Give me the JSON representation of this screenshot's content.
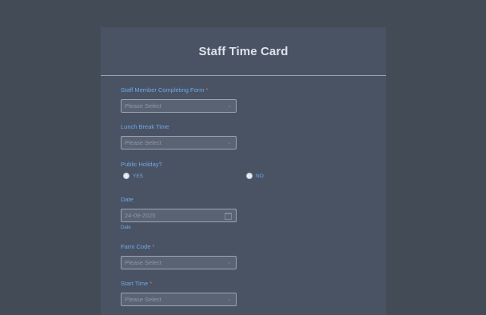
{
  "form": {
    "title": "Staff Time Card",
    "fields": {
      "staff_member": {
        "label": "Staff Member Completing Form",
        "required_mark": "*",
        "placeholder": "Please Select"
      },
      "lunch_break": {
        "label": "Lunch Break Time",
        "placeholder": "Please Select"
      },
      "public_holiday": {
        "label": "Public Holiday?",
        "options": [
          "YES",
          "NO"
        ]
      },
      "date": {
        "label": "Date",
        "value": "24-09-2025",
        "sublabel": "Date"
      },
      "farm_code": {
        "label": "Farm Code",
        "required_mark": "*",
        "placeholder": "Please Select"
      },
      "start_time": {
        "label": "Start Time",
        "required_mark": "*",
        "placeholder": "Please Select"
      }
    }
  },
  "colors": {
    "background": "#434b57",
    "card": "#4a5363",
    "label": "#6fa8ec",
    "required": "#e36a6a",
    "title": "#dde2ea"
  },
  "icons": {
    "dropdown": "chevron-down-icon",
    "calendar": "calendar-icon"
  }
}
